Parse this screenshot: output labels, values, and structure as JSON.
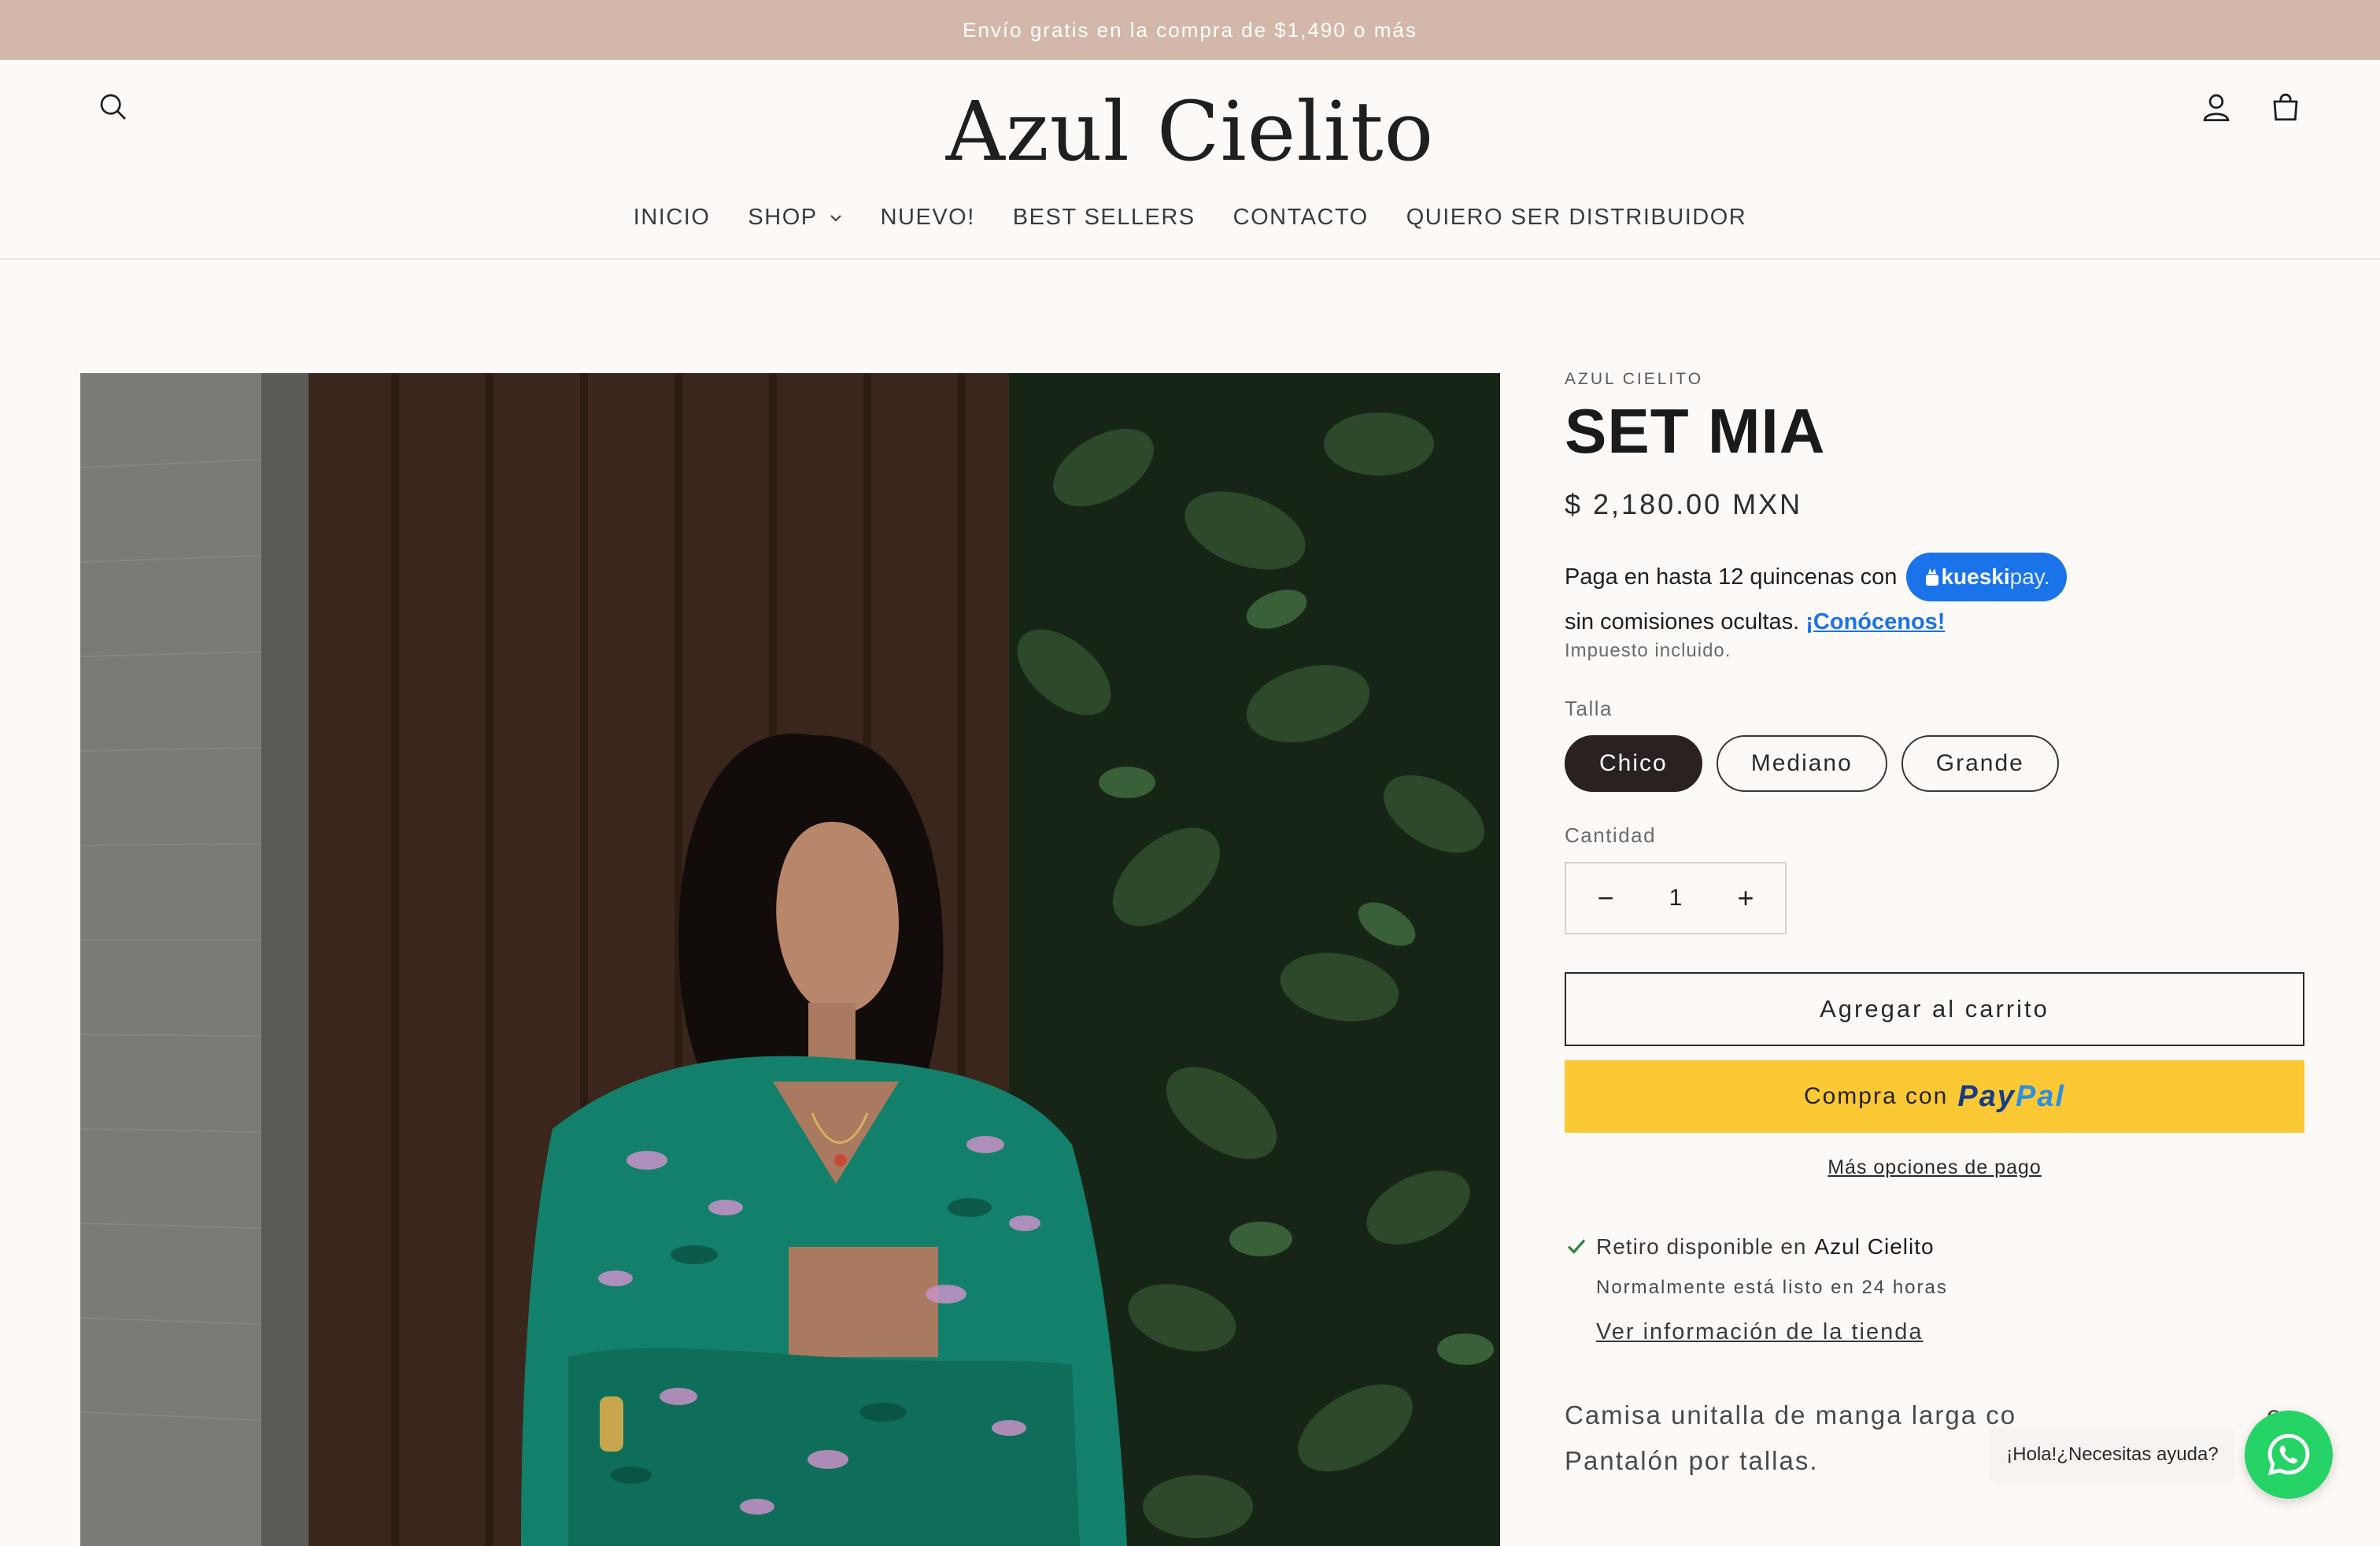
{
  "announcement": "Envío gratis en la compra de $1,490 o más",
  "header": {
    "logo": "Azul Cielito",
    "icons": {
      "search": "search-icon",
      "account": "account-icon",
      "cart": "cart-icon"
    }
  },
  "nav": {
    "items": [
      "INICIO",
      "SHOP",
      "NUEVO!",
      "BEST SELLERS",
      "CONTACTO",
      "QUIERO SER DISTRIBUIDOR"
    ]
  },
  "product": {
    "vendor": "AZUL CIELITO",
    "title": "SET MIA",
    "price": "$ 2,180.00 MXN",
    "kueski": {
      "line1": "Paga en hasta 12 quincenas con",
      "badge_brand": "kueski",
      "badge_pay": "pay.",
      "line2": "sin comisiones ocultas.",
      "link": "¡Conócenos!"
    },
    "tax_note": "Impuesto incluido.",
    "size_label": "Talla",
    "sizes": [
      "Chico",
      "Mediano",
      "Grande"
    ],
    "selected_size": "Chico",
    "quantity_label": "Cantidad",
    "quantity": "1",
    "add_to_cart": "Agregar al carrito",
    "paypal_prefix": "Compra con",
    "paypal_brand_a": "Pay",
    "paypal_brand_b": "Pal",
    "more_payment": "Más opciones de pago",
    "pickup": {
      "text": "Retiro disponible en",
      "store": "Azul Cielito",
      "sub": "Normalmente está listo en 24 horas",
      "link": "Ver información de la tienda"
    },
    "description_line1": "Camisa unitalla de manga larga co",
    "description_line1_end": "e",
    "description_line2": "Pantalón por tallas."
  },
  "whatsapp": {
    "bubble": "¡Hola!¿Necesitas ayuda?"
  },
  "colors": {
    "announcement_bg": "#d3b7a9",
    "kueski_blue": "#1a73e8",
    "paypal_yellow": "#fcc934",
    "whatsapp_green": "#25d366"
  }
}
